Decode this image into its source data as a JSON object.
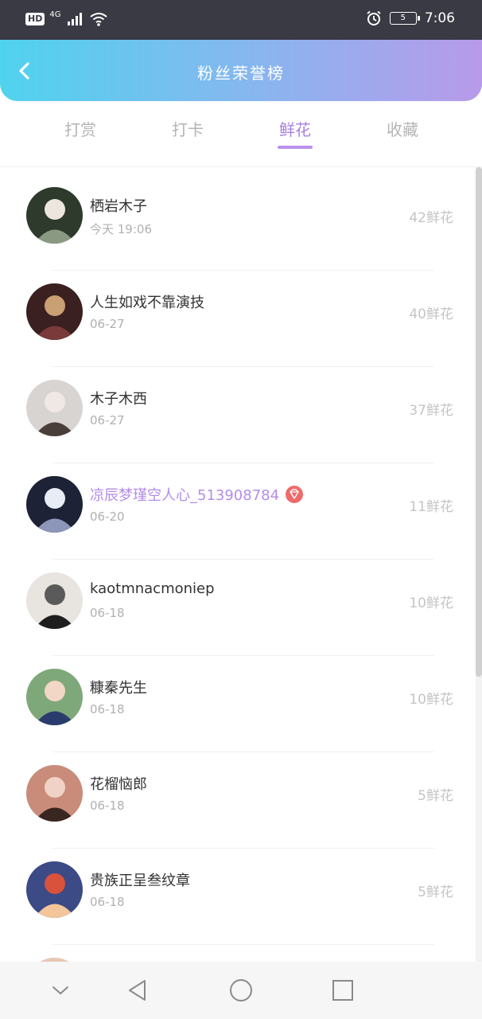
{
  "status_bar": {
    "hd": "HD",
    "network_type": "4G",
    "battery_level": "5",
    "time": "7:06"
  },
  "header": {
    "title": "粉丝荣誉榜"
  },
  "tabs": [
    {
      "label": "打赏"
    },
    {
      "label": "打卡"
    },
    {
      "label": "鲜花",
      "active": true
    },
    {
      "label": "收藏"
    }
  ],
  "rows": [
    {
      "name": "栖岩木子",
      "time": "今天 19:06",
      "flowers": "42鲜花",
      "vip": false,
      "avatar_colors": [
        "#2d3a2c",
        "#8a9a82",
        "#ece6df"
      ]
    },
    {
      "name": "人生如戏不靠演技",
      "time": "06-27",
      "flowers": "40鲜花",
      "vip": false,
      "avatar_colors": [
        "#3a2020",
        "#7a3a3a",
        "#c9a074"
      ]
    },
    {
      "name": "木子木西",
      "time": "06-27",
      "flowers": "37鲜花",
      "vip": false,
      "avatar_colors": [
        "#d8d4d2",
        "#4a3e3a",
        "#f0e8e4"
      ]
    },
    {
      "name": "凉辰梦瑾空人心_513908784",
      "time": "06-20",
      "flowers": "11鲜花",
      "vip": true,
      "avatar_colors": [
        "#1e2236",
        "#8c96b8",
        "#e8ecf4"
      ]
    },
    {
      "name": "kaotmnacmoniep",
      "time": "06-18",
      "flowers": "10鲜花",
      "vip": false,
      "avatar_colors": [
        "#e8e4e0",
        "#1e1e1e",
        "#5a5a5a"
      ]
    },
    {
      "name": "糠秦先生",
      "time": "06-18",
      "flowers": "10鲜花",
      "vip": false,
      "avatar_colors": [
        "#7fa87a",
        "#2a3c6e",
        "#f2d6c6"
      ]
    },
    {
      "name": "花榴恼郎",
      "time": "06-18",
      "flowers": "5鲜花",
      "vip": false,
      "avatar_colors": [
        "#c98b7a",
        "#3a2620",
        "#f1d2c6"
      ]
    },
    {
      "name": "贵族正呈叁纹章",
      "time": "06-18",
      "flowers": "5鲜花",
      "vip": false,
      "avatar_colors": [
        "#3c4a86",
        "#f3c59a",
        "#d8523c"
      ]
    },
    {
      "name": "",
      "time": "",
      "flowers": "",
      "vip": false,
      "avatar_colors": [
        "#e8c8b4",
        "#5a3a2a",
        "#f4e0d4"
      ]
    }
  ],
  "colors": {
    "accent": "#a87fe3",
    "header_gradient": [
      "#4fd3ee",
      "#b89aea"
    ]
  },
  "icons": {
    "back": "chevron-left-icon",
    "vip": "diamond-icon",
    "nav": [
      "chevron-down-icon",
      "back-triangle-icon",
      "home-circle-icon",
      "recents-square-icon"
    ]
  }
}
